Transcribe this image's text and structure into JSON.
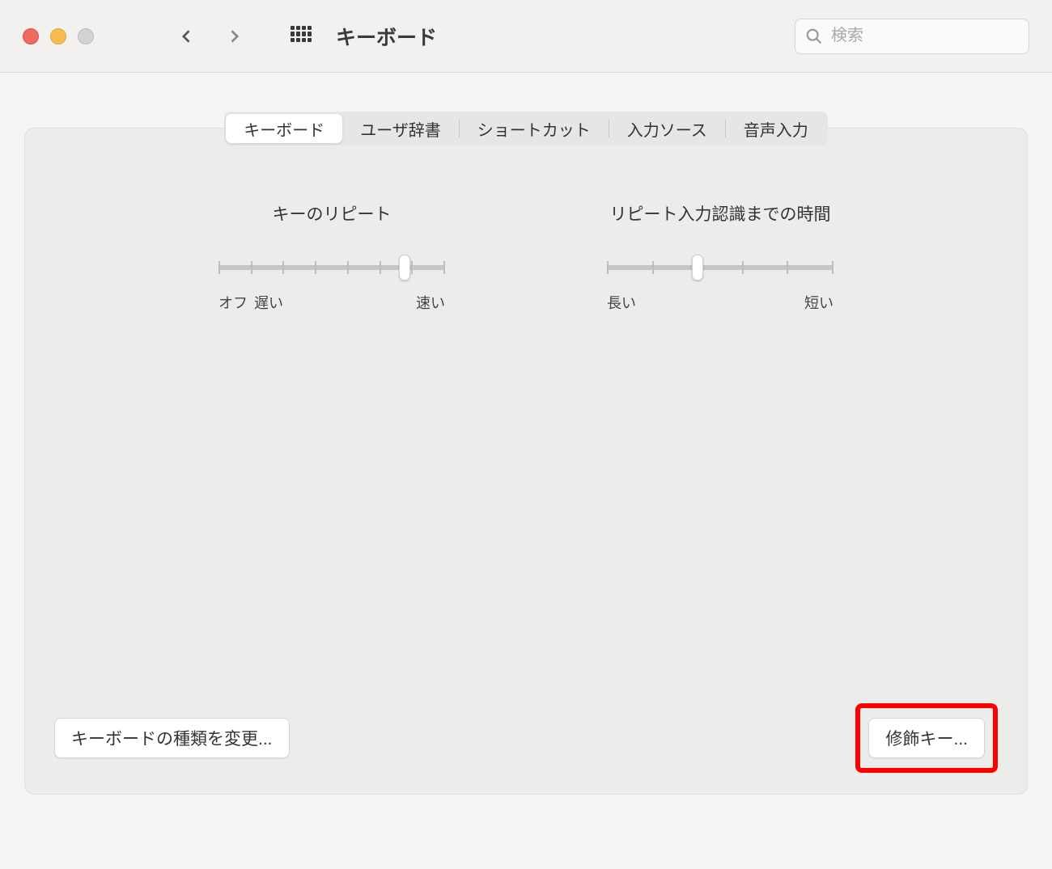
{
  "toolbar": {
    "title": "キーボード",
    "search_placeholder": "検索"
  },
  "tabs": [
    {
      "label": "キーボード",
      "active": true
    },
    {
      "label": "ユーザ辞書",
      "active": false
    },
    {
      "label": "ショートカット",
      "active": false
    },
    {
      "label": "入力ソース",
      "active": false
    },
    {
      "label": "音声入力",
      "active": false
    }
  ],
  "sliders": {
    "key_repeat": {
      "title": "キーのリピート",
      "ticks": 8,
      "position_percent": 82,
      "label_off": "オフ",
      "label_slow": "遅い",
      "label_fast": "速い"
    },
    "delay_until_repeat": {
      "title": "リピート入力認識までの時間",
      "ticks": 6,
      "position_percent": 40,
      "label_long": "長い",
      "label_short": "短い"
    }
  },
  "buttons": {
    "change_keyboard_type": "キーボードの種類を変更...",
    "modifier_keys": "修飾キー..."
  }
}
